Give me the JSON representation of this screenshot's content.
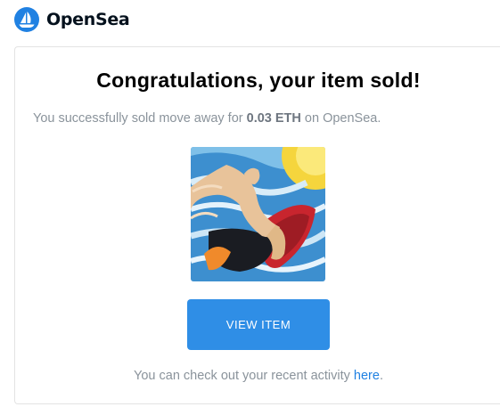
{
  "brand": {
    "name": "OpenSea",
    "color": "#2081e2"
  },
  "email": {
    "title": "Congratulations, your item sold!",
    "sold_prefix": "You successfully sold move away for",
    "price": "0.03 ETH",
    "sold_suffix": "on OpenSea.",
    "item_image_alt": "move away",
    "view_button_label": "VIEW ITEM",
    "view_button_color": "#2f8ee6",
    "recent_text": "You can check out your recent activity",
    "recent_link": "here",
    "recent_period": "."
  }
}
